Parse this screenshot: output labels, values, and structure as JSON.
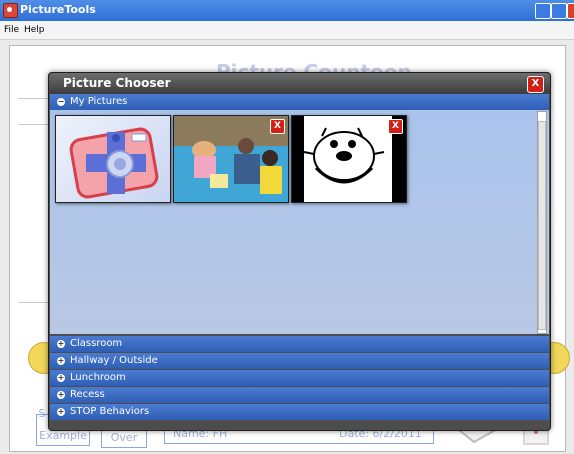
{
  "window": {
    "title": "PictureTools",
    "app_icon": "picturetools-app-icon",
    "controls": [
      "minimize",
      "maximize",
      "close"
    ]
  },
  "menu": {
    "items": [
      "File",
      "Help"
    ]
  },
  "background_app": {
    "title": "Picture Countoon",
    "example_button": "Example",
    "start_over_button": "Over",
    "start_over_prefix": "Start",
    "name_field": "Name: FH",
    "date_field": "Date: 6/2/2011"
  },
  "dialog": {
    "title": "Picture Chooser",
    "close_label": "X",
    "my_pictures": {
      "label": "My Pictures",
      "expanded": true,
      "items": [
        {
          "name": "camera-add-photo",
          "deletable": false
        },
        {
          "name": "children-playing-photo",
          "deletable": true
        },
        {
          "name": "tiger-cartoon-photo",
          "deletable": true
        }
      ]
    },
    "categories": [
      {
        "label": "Classroom"
      },
      {
        "label": "Hallway / Outside"
      },
      {
        "label": "Lunchroom"
      },
      {
        "label": "Recess"
      },
      {
        "label": "STOP Behaviors"
      }
    ],
    "delete_label": "X"
  },
  "colors": {
    "section_blue": "#3a6ac3",
    "close_red": "#d32016",
    "dialog_gray": "#4d4d4d"
  }
}
